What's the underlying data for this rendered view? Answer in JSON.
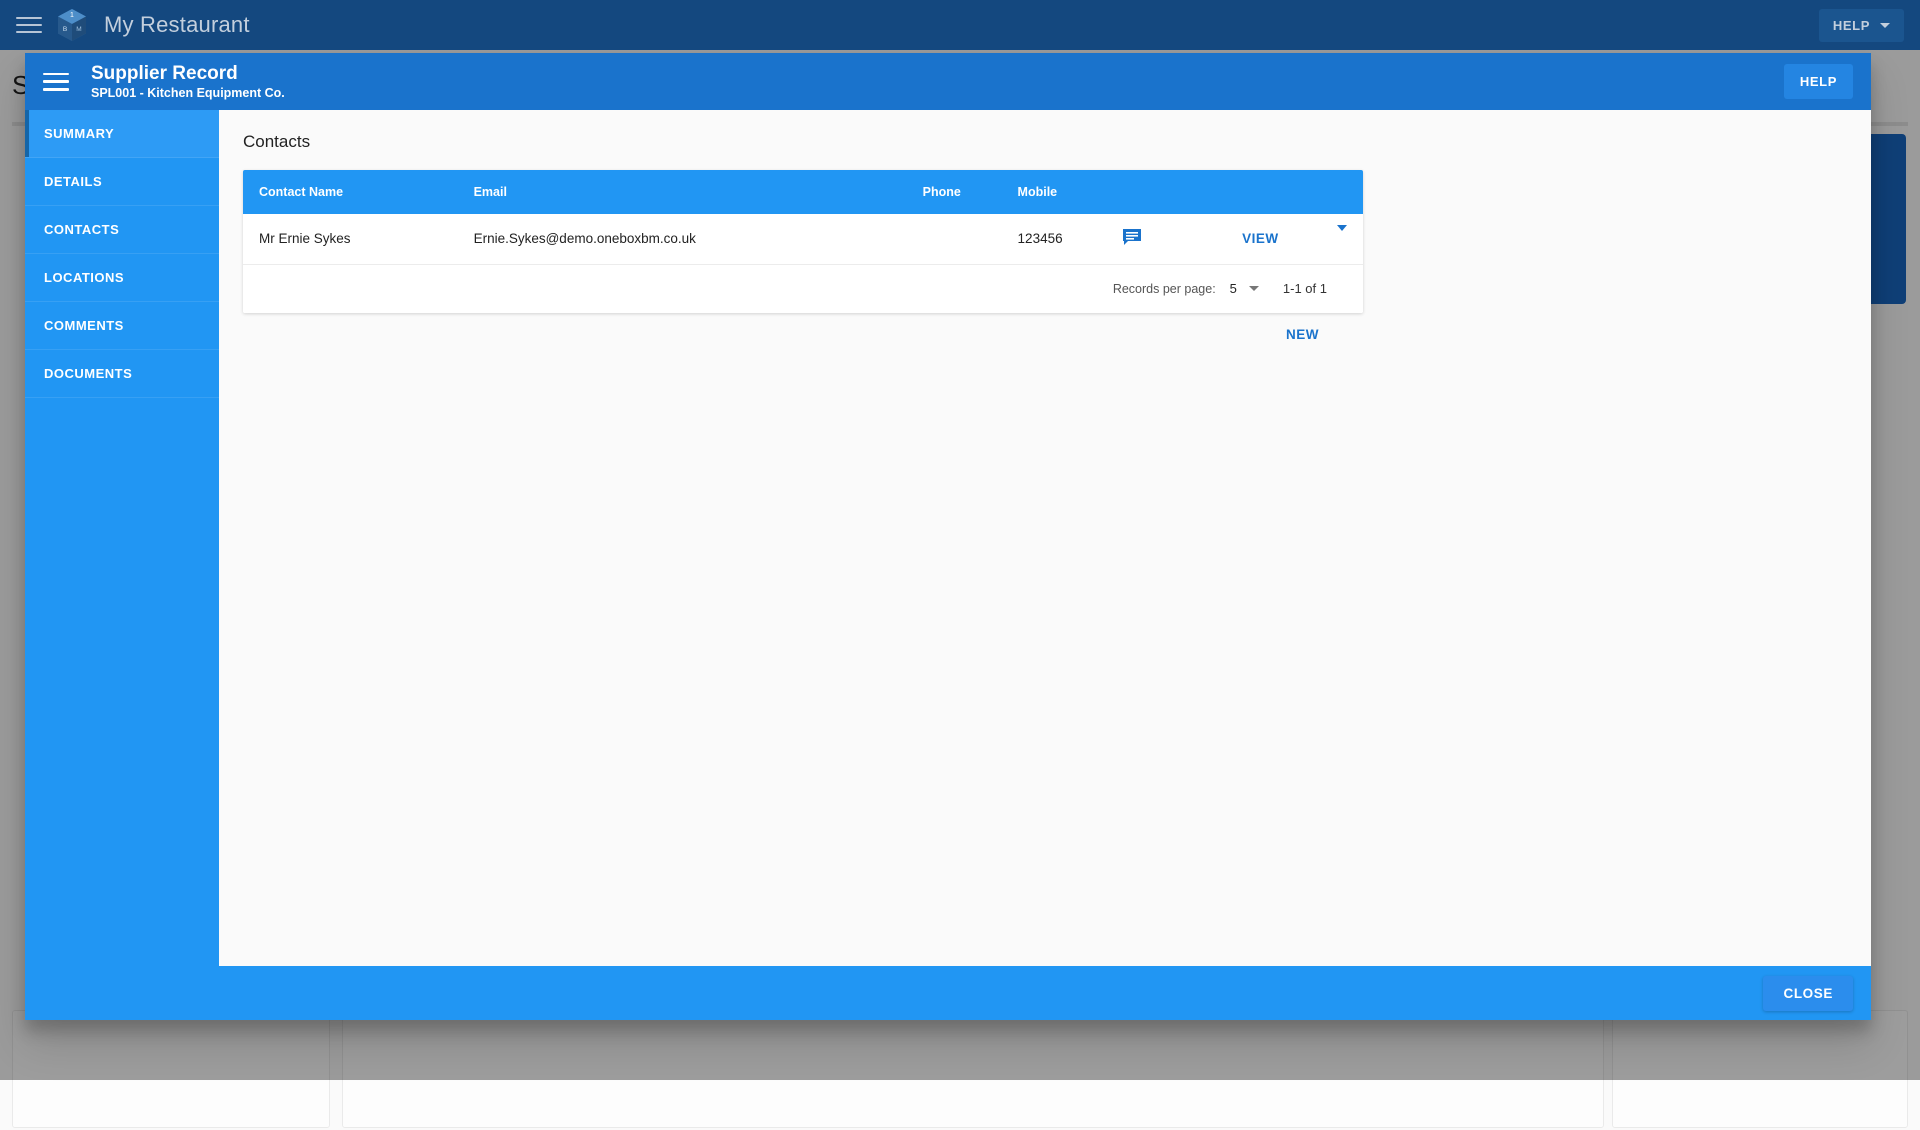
{
  "app_bar": {
    "menu_icon": "hamburger-menu-icon",
    "logo_icon": "cube-logo-icon",
    "logo_letters": [
      "1",
      "B",
      "M"
    ],
    "title": "My Restaurant",
    "help_label": "HELP",
    "help_caret_icon": "chevron-down-icon"
  },
  "background": {
    "heading": "S",
    "colors": {
      "bar": "#14487f",
      "panel": "#1967c0",
      "scrim": "rgba(0,0,0,0.38)"
    }
  },
  "dialog": {
    "menu_icon": "hamburger-menu-icon",
    "title": "Supplier Record",
    "subtitle": "SPL001 - Kitchen Equipment Co.",
    "help_label": "HELP",
    "close_label": "CLOSE",
    "sidebar": {
      "items": [
        {
          "label": "SUMMARY",
          "active": true
        },
        {
          "label": "DETAILS",
          "active": false
        },
        {
          "label": "CONTACTS",
          "active": false
        },
        {
          "label": "LOCATIONS",
          "active": false
        },
        {
          "label": "COMMENTS",
          "active": false
        },
        {
          "label": "DOCUMENTS",
          "active": false
        }
      ]
    },
    "content": {
      "section_title": "Contacts",
      "table": {
        "columns": [
          "Contact Name",
          "Email",
          "Phone",
          "Mobile"
        ],
        "rows": [
          {
            "contact_name": "Mr Ernie Sykes",
            "email": "Ernie.Sykes@demo.oneboxbm.co.uk",
            "phone": "",
            "mobile": "123456",
            "comment_icon": "comment-bubble-icon",
            "action_label": "VIEW",
            "expand_icon": "chevron-down-icon"
          }
        ]
      },
      "pagination": {
        "records_per_page_label": "Records per page:",
        "records_per_page_value": "5",
        "select_caret_icon": "chevron-down-icon",
        "range_label": "1-1 of 1"
      },
      "new_label": "NEW"
    }
  },
  "theme": {
    "primary": "#2196f3",
    "dark_blue": "#14487f",
    "header_blue": "#1a73cc",
    "link_blue": "#1a73cc"
  }
}
